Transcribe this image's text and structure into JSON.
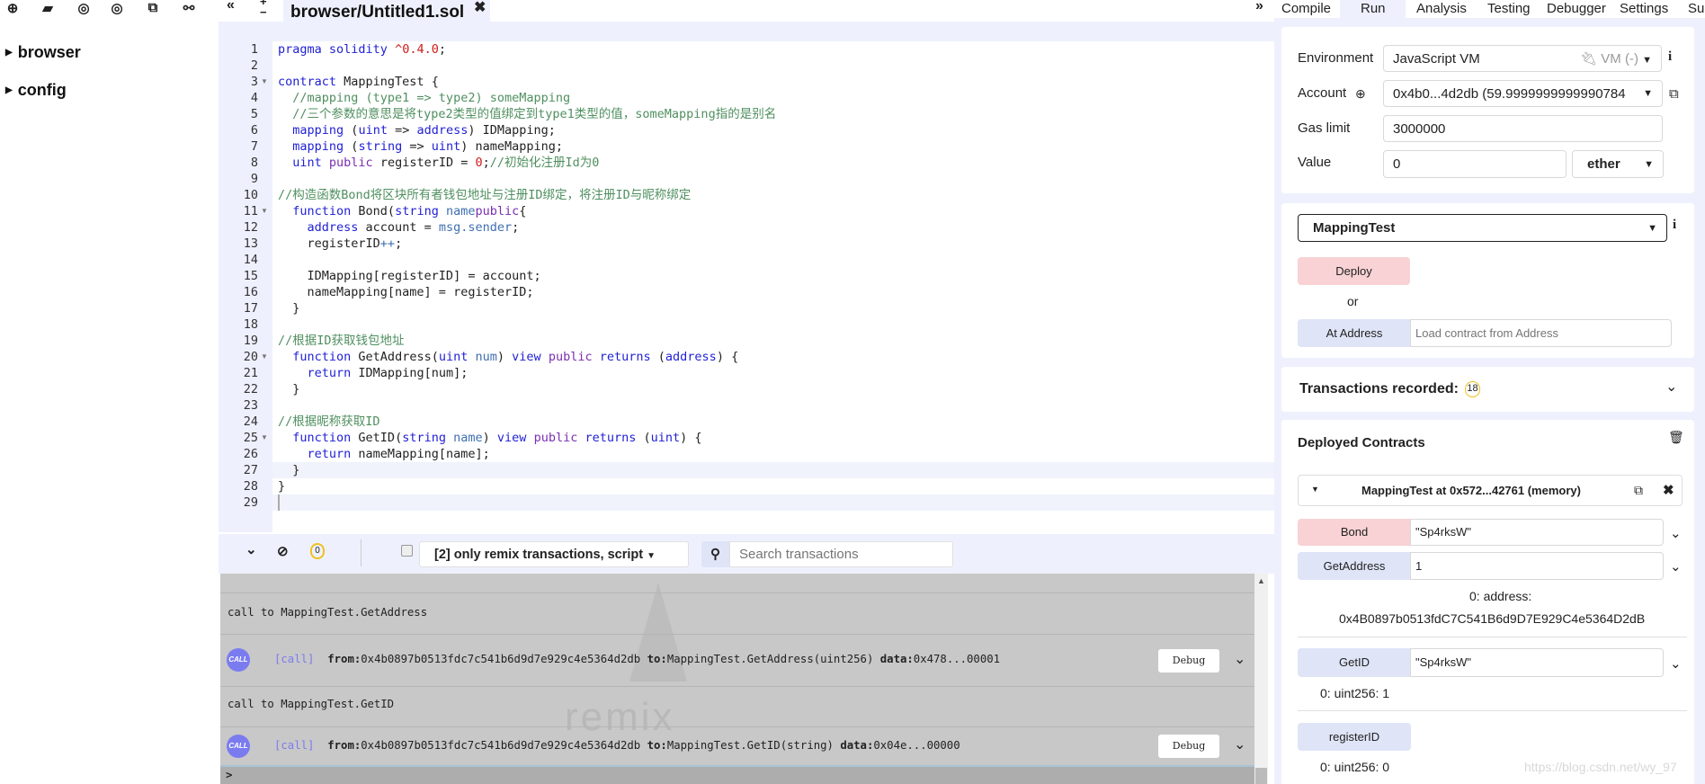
{
  "file_toolbar": {
    "icons": [
      "plus-circle-icon",
      "folder-open-icon",
      "github-icon",
      "github-gist-icon",
      "copy-files-icon",
      "link-icon"
    ]
  },
  "file_tree": [
    {
      "label": "browser"
    },
    {
      "label": "config"
    }
  ],
  "editor": {
    "tab_label": "browser/Untitled1.sol",
    "lines": [
      [
        [
          "k",
          "pragma solidity"
        ],
        [
          "",
          ""
        ],
        [
          "",
          " "
        ],
        [
          "n",
          "^0.4.0"
        ],
        [
          "",
          ";"
        ]
      ],
      [],
      [
        [
          "k",
          "contract"
        ],
        [
          "",
          " MappingTest {"
        ]
      ],
      [
        [
          "c",
          "  //mapping (type1 => type2) someMapping"
        ]
      ],
      [
        [
          "c",
          "  //三个参数的意思是将type2类型的值绑定到type1类型的值，someMapping指的是别名"
        ]
      ],
      [
        [
          "",
          "  "
        ],
        [
          "k",
          "mapping"
        ],
        [
          "",
          " ("
        ],
        [
          "t",
          "uint"
        ],
        [
          "",
          " => "
        ],
        [
          "t",
          "address"
        ],
        [
          "",
          ") IDMapping;"
        ]
      ],
      [
        [
          "",
          "  "
        ],
        [
          "k",
          "mapping"
        ],
        [
          "",
          " ("
        ],
        [
          "t",
          "string"
        ],
        [
          "",
          " => "
        ],
        [
          "t",
          "uint"
        ],
        [
          "",
          ") nameMapping;"
        ]
      ],
      [
        [
          "",
          "  "
        ],
        [
          "t",
          "uint"
        ],
        [
          "",
          " "
        ],
        [
          "p",
          "public"
        ],
        [
          "",
          " registerID = "
        ],
        [
          "n",
          "0"
        ],
        [
          "",
          ";"
        ],
        [
          "c",
          "//初始化注册Id为0"
        ]
      ],
      [],
      [
        [
          "c",
          "//构造函数Bond将区块所有者钱包地址与注册ID绑定，将注册ID与昵称绑定"
        ]
      ],
      [
        [
          "",
          "  "
        ],
        [
          "k",
          "function"
        ],
        [
          "",
          " Bond("
        ],
        [
          "t",
          "string"
        ],
        [
          "",
          " "
        ],
        [
          "v",
          "name"
        ],
        [
          ") "
        ],
        [
          "p",
          "public"
        ],
        [
          "",
          "{"
        ]
      ],
      [
        [
          "",
          "    "
        ],
        [
          "t",
          "address"
        ],
        [
          "",
          " account = "
        ],
        [
          "v",
          "msg.sender"
        ],
        [
          "",
          ";"
        ]
      ],
      [
        [
          "",
          "    registerID"
        ],
        [
          "v",
          "++"
        ],
        [
          "",
          ";"
        ]
      ],
      [],
      [
        [
          "",
          "    IDMapping[registerID] = account;"
        ]
      ],
      [
        [
          "",
          "    nameMapping[name] = registerID;"
        ]
      ],
      [
        [
          "",
          "  }"
        ]
      ],
      [],
      [
        [
          "c",
          "//根据ID获取钱包地址"
        ]
      ],
      [
        [
          "",
          "  "
        ],
        [
          "k",
          "function"
        ],
        [
          "",
          " GetAddress("
        ],
        [
          "t",
          "uint"
        ],
        [
          "",
          " "
        ],
        [
          "v",
          "num"
        ],
        [
          "",
          ") "
        ],
        [
          "k",
          "view"
        ],
        [
          "",
          " "
        ],
        [
          "p",
          "public"
        ],
        [
          "",
          " "
        ],
        [
          "k",
          "returns"
        ],
        [
          "",
          " ("
        ],
        [
          "t",
          "address"
        ],
        [
          "",
          ") {"
        ]
      ],
      [
        [
          "",
          "    "
        ],
        [
          "k",
          "return"
        ],
        [
          "",
          " IDMapping[num];"
        ]
      ],
      [
        [
          "",
          "  }"
        ]
      ],
      [],
      [
        [
          "c",
          "//根据昵称获取ID"
        ]
      ],
      [
        [
          "",
          "  "
        ],
        [
          "k",
          "function"
        ],
        [
          "",
          " GetID("
        ],
        [
          "t",
          "string"
        ],
        [
          "",
          " "
        ],
        [
          "v",
          "name"
        ],
        [
          "",
          ") "
        ],
        [
          "k",
          "view"
        ],
        [
          "",
          " "
        ],
        [
          "p",
          "public"
        ],
        [
          "",
          " "
        ],
        [
          "k",
          "returns"
        ],
        [
          "",
          " ("
        ],
        [
          "t",
          "uint"
        ],
        [
          "",
          ") {"
        ]
      ],
      [
        [
          "",
          "    "
        ],
        [
          "k",
          "return"
        ],
        [
          "",
          " nameMapping[name];"
        ]
      ],
      [
        [
          "",
          "  }"
        ]
      ],
      [
        [
          "",
          "}"
        ]
      ],
      []
    ],
    "folded_lines": [
      3,
      11,
      20,
      25
    ]
  },
  "terminal": {
    "pending_count": "0",
    "filter_label": "[2] only remix transactions, script",
    "search_placeholder": "Search transactions",
    "watermark": "remix",
    "entries": [
      {
        "title": "call to MappingTest.GetAddress",
        "badge": "CALL",
        "tag": "[call]",
        "from": "0x4b0897b0513fdc7c541b6d9d7e929c4e5364d2db",
        "to": "MappingTest.GetAddress(uint256)",
        "data": "0x478...00001",
        "debug": "Debug"
      },
      {
        "title": "call to MappingTest.GetID",
        "badge": "CALL",
        "tag": "[call]",
        "from": "0x4b0897b0513fdc7c541b6d9d7e929c4e5364d2db",
        "to": "MappingTest.GetID(string)",
        "data": "0x04e...00000",
        "debug": "Debug"
      }
    ],
    "labels": {
      "from": "from:",
      "to": "to:",
      "data": "data:"
    },
    "prompt": ">"
  },
  "right_tabs": [
    "Compile",
    "Run",
    "Analysis",
    "Testing",
    "Debugger",
    "Settings",
    "Su"
  ],
  "run": {
    "environment_label": "Environment",
    "environment_value": "JavaScript VM",
    "environment_network": "VM (-)",
    "account_label": "Account",
    "account_value": "0x4b0...4d2db (59.9999999999990784",
    "gas_label": "Gas limit",
    "gas_value": "3000000",
    "value_label": "Value",
    "value_value": "0",
    "value_unit": "ether",
    "contract_select": "MappingTest",
    "deploy_label": "Deploy",
    "or_label": "or",
    "at_address_label": "At Address",
    "at_address_placeholder": "Load contract from Address",
    "transactions_label": "Transactions recorded:",
    "transactions_count": "18",
    "deployed_title": "Deployed Contracts",
    "instance_title": "MappingTest at 0x572...42761 (memory)",
    "functions": {
      "bond": {
        "label": "Bond",
        "value": "\"Sp4rksW\""
      },
      "getaddress": {
        "label": "GetAddress",
        "value": "1",
        "result1": "0: address:",
        "result2": "0x4B0897b0513fdC7C541B6d9D7E929C4e5364D2dB"
      },
      "getid": {
        "label": "GetID",
        "value": "\"Sp4rksW\"",
        "result": "0: uint256: 1"
      },
      "registerid": {
        "label": "registerID",
        "result": "0: uint256: 0"
      }
    }
  },
  "watermark": "https://blog.csdn.net/wy_97",
  "colors": {
    "deploy": "#f8d2d4",
    "call_button": "#dfe4f7",
    "panel_bg": "#eef1fd",
    "terminal_bg": "#c8c8c8"
  }
}
